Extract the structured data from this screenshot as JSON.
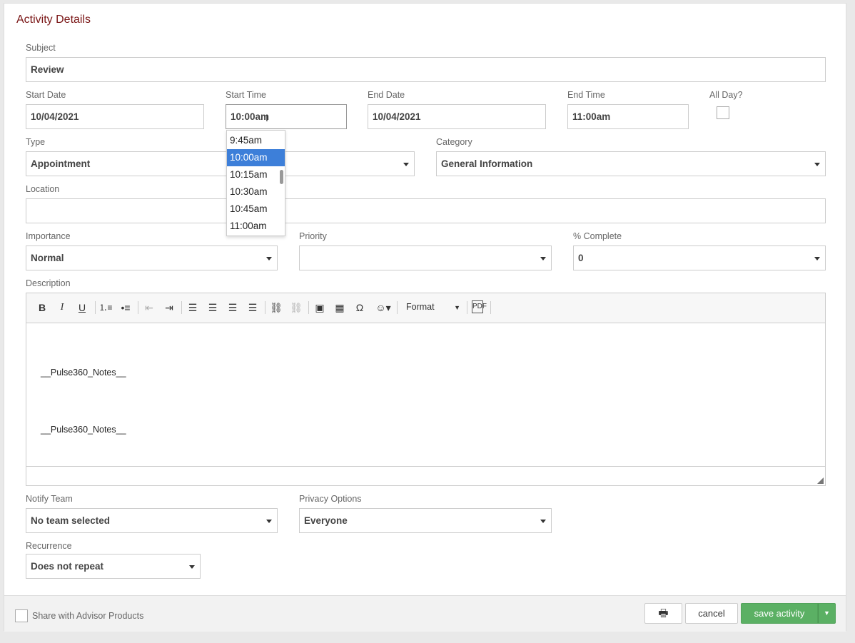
{
  "title": "Activity Details",
  "subject": {
    "label": "Subject",
    "value": "Review"
  },
  "start_date": {
    "label": "Start Date",
    "value": "10/04/2021"
  },
  "start_time": {
    "label": "Start Time",
    "value": "10:00am",
    "options": [
      "9:45am",
      "10:00am",
      "10:15am",
      "10:30am",
      "10:45am",
      "11:00am"
    ],
    "selected": "10:00am"
  },
  "end_date": {
    "label": "End Date",
    "value": "10/04/2021"
  },
  "end_time": {
    "label": "End Time",
    "value": "11:00am"
  },
  "all_day": {
    "label": "All Day?",
    "checked": false
  },
  "type": {
    "label": "Type",
    "value": "Appointment"
  },
  "category": {
    "label": "Category",
    "value": "General Information"
  },
  "location": {
    "label": "Location",
    "value": ""
  },
  "importance": {
    "label": "Importance",
    "value": "Normal"
  },
  "priority": {
    "label": "Priority",
    "value": ""
  },
  "complete": {
    "label": "% Complete",
    "value": "0"
  },
  "description": {
    "label": "Description",
    "format_label": "Format",
    "lines": [
      "__Pulse360_Notes__",
      "__Pulse360_Notes__"
    ]
  },
  "notify_team": {
    "label": "Notify Team",
    "value": "No team selected"
  },
  "privacy": {
    "label": "Privacy Options",
    "value": "Everyone"
  },
  "recurrence": {
    "label": "Recurrence",
    "value": "Does not repeat"
  },
  "footer": {
    "share_label": "Share with Advisor Products",
    "cancel_label": "cancel",
    "save_label": "save activity"
  },
  "colors": {
    "title": "#7a1616",
    "accent": "#3d7fd9",
    "save": "#5bb064"
  }
}
